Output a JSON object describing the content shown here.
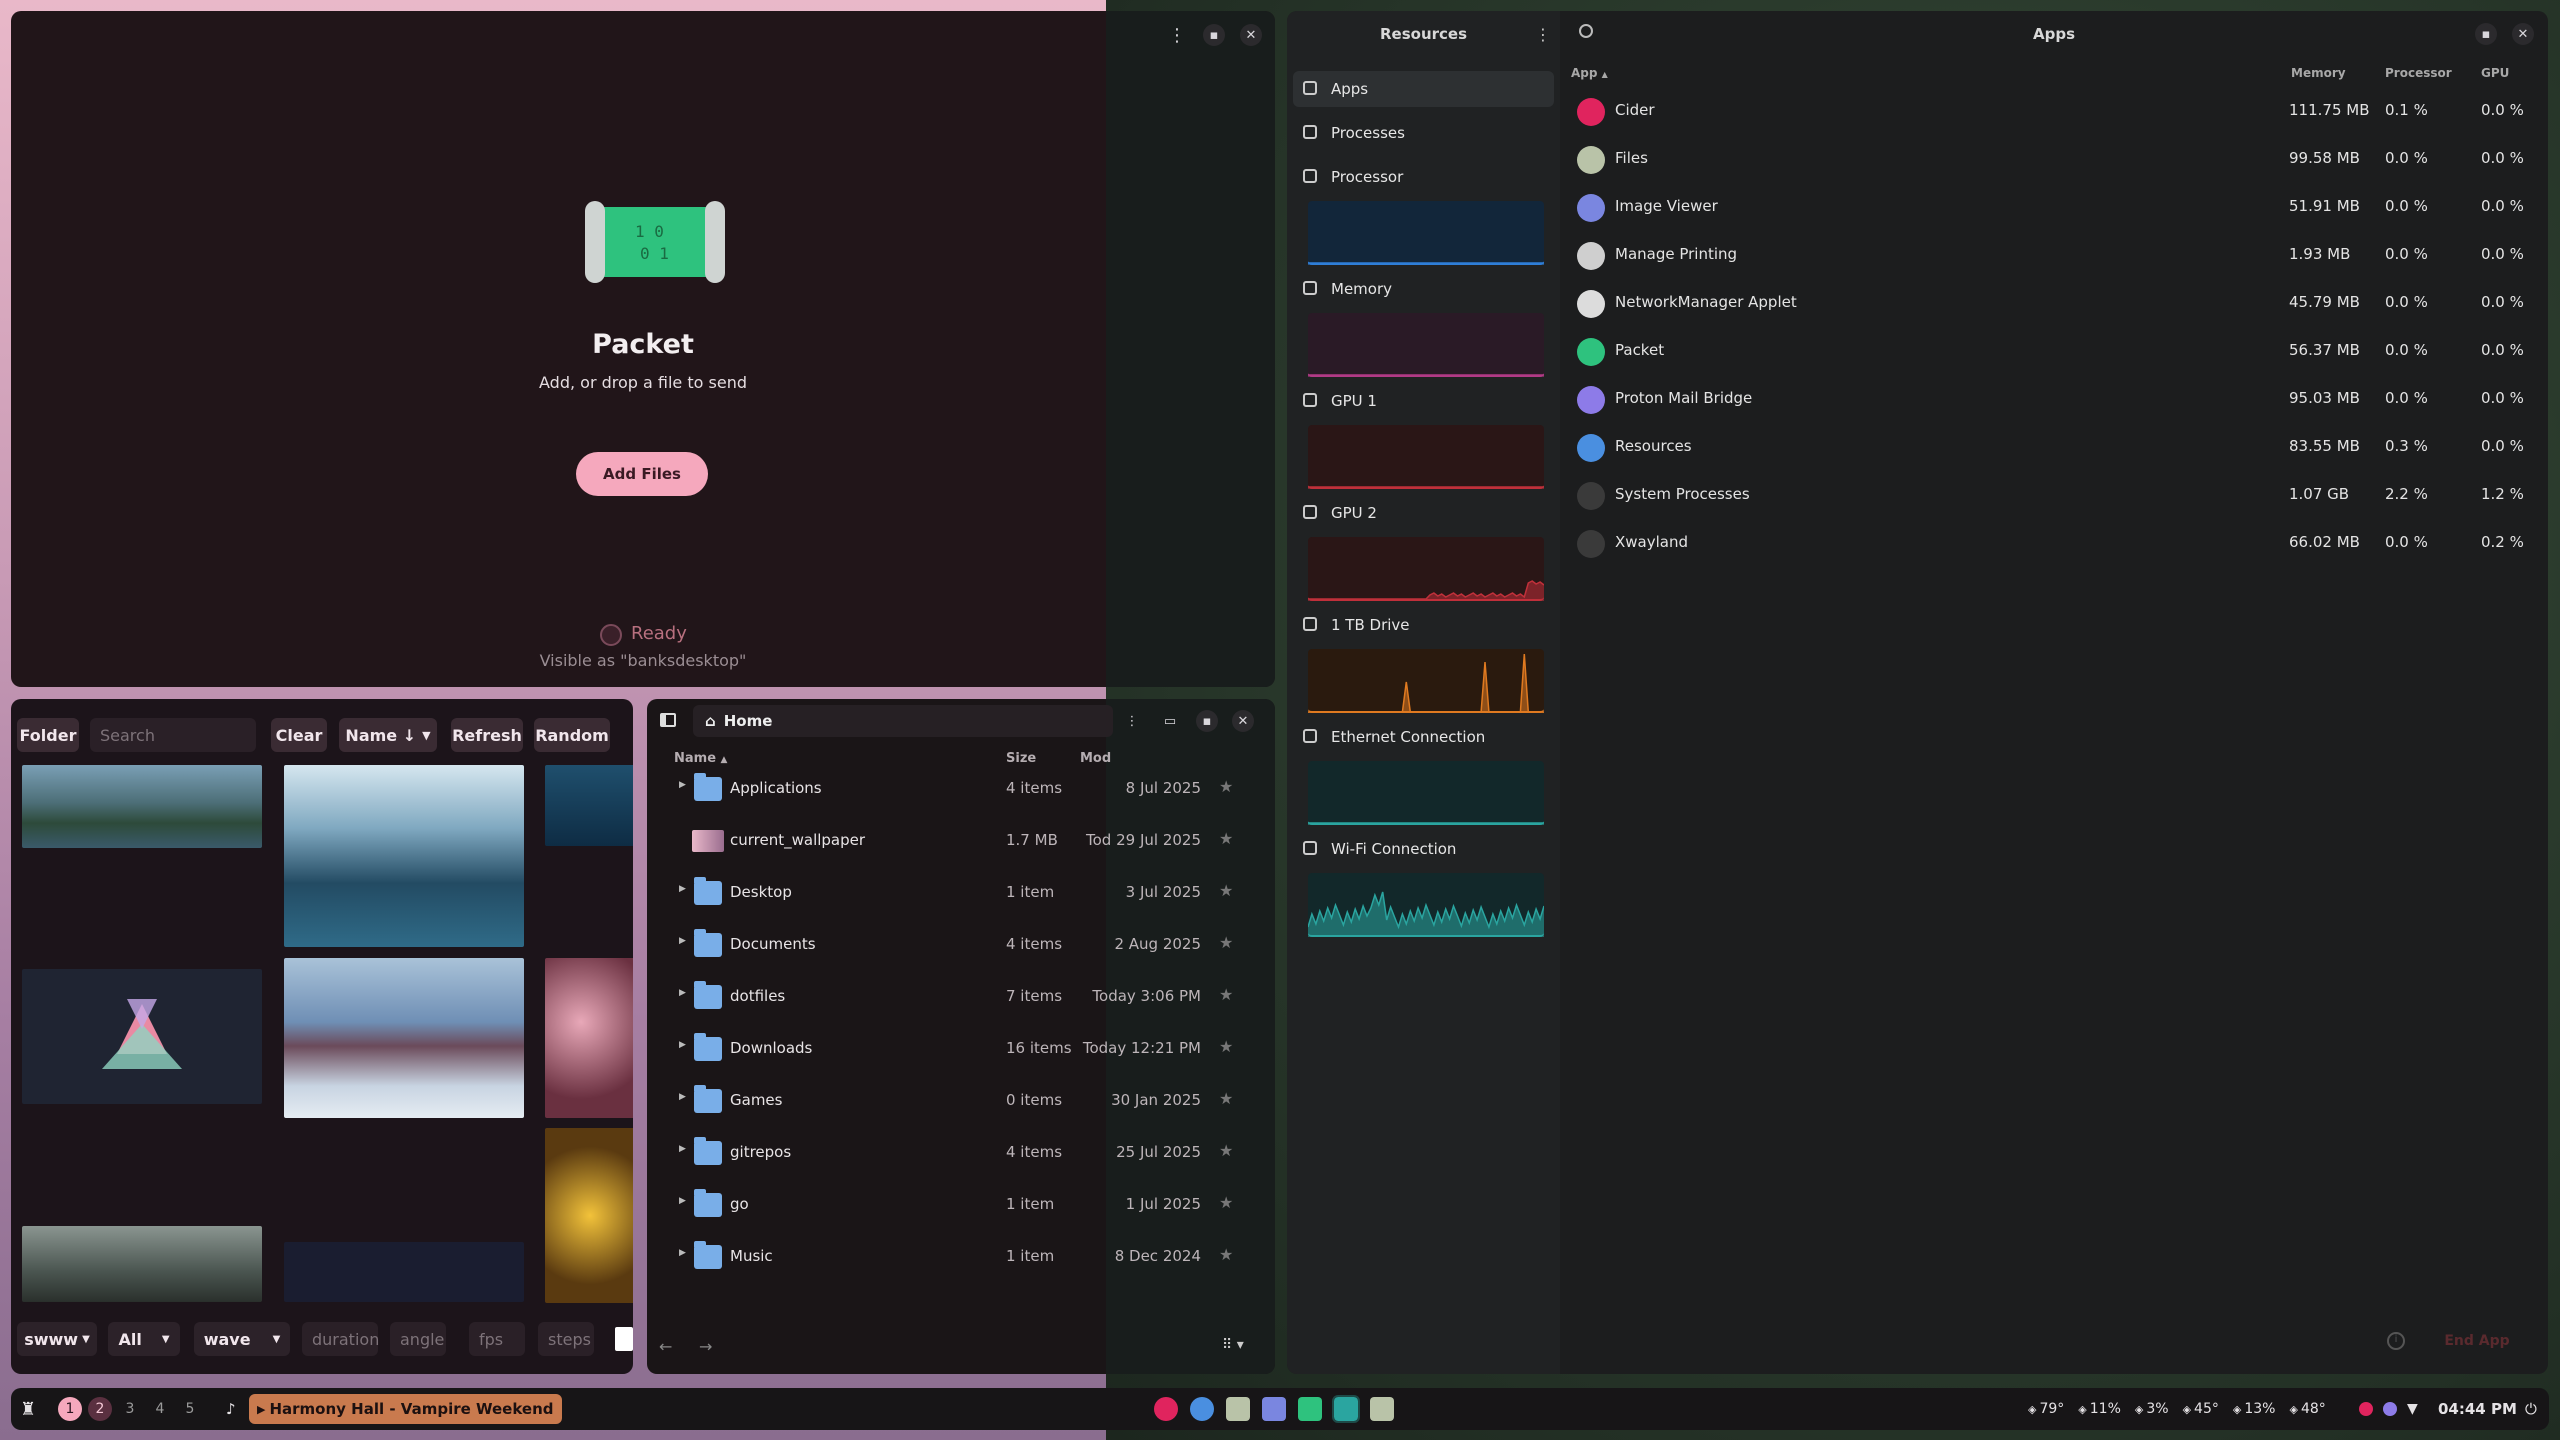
{
  "packet": {
    "title": "Packet",
    "subtitle": "Add, or drop a file to send",
    "add_button": "Add Files",
    "status": "Ready",
    "visible_as": "Visible as \"banksdesktop\""
  },
  "wallpaper_picker": {
    "folder_button": "Folder",
    "search_placeholder": "Search",
    "clear_button": "Clear",
    "sort_button": "Name ↓",
    "refresh_button": "Refresh",
    "random_button": "Random",
    "backend": "swww",
    "filter": "All",
    "transition": "wave",
    "duration_placeholder": "duration",
    "angle_placeholder": "angle",
    "fps_placeholder": "fps",
    "steps_placeholder": "steps"
  },
  "files": {
    "location": "Home",
    "col_name": "Name",
    "col_size": "Size",
    "col_modified": "Mod",
    "rows": [
      {
        "name": "Applications",
        "size": "4 items",
        "modified": "8 Jul 2025",
        "type": "folder"
      },
      {
        "name": "current_wallpaper",
        "size": "1.7 MB",
        "modified": "Tod 29 Jul 2025",
        "type": "image"
      },
      {
        "name": "Desktop",
        "size": "1 item",
        "modified": "3 Jul 2025",
        "type": "folder"
      },
      {
        "name": "Documents",
        "size": "4 items",
        "modified": "2 Aug 2025",
        "type": "folder"
      },
      {
        "name": "dotfiles",
        "size": "7 items",
        "modified": "Today 3:06 PM",
        "type": "folder"
      },
      {
        "name": "Downloads",
        "size": "16 items",
        "modified": "Today 12:21 PM",
        "type": "folder"
      },
      {
        "name": "Games",
        "size": "0 items",
        "modified": "30 Jan 2025",
        "type": "folder"
      },
      {
        "name": "gitrepos",
        "size": "4 items",
        "modified": "25 Jul 2025",
        "type": "folder"
      },
      {
        "name": "go",
        "size": "1 item",
        "modified": "1 Jul 2025",
        "type": "folder"
      },
      {
        "name": "Music",
        "size": "1 item",
        "modified": "8 Dec 2024",
        "type": "folder"
      }
    ]
  },
  "resources": {
    "sidebar_title": "Resources",
    "main_title": "Apps",
    "sidebar_items": [
      {
        "label": "Apps",
        "icon": "apps-icon"
      },
      {
        "label": "Processes",
        "icon": "processes-icon"
      },
      {
        "label": "Processor",
        "icon": "cpu-icon"
      },
      {
        "label": "Memory",
        "icon": "memory-icon"
      },
      {
        "label": "GPU 1",
        "icon": "gpu-icon"
      },
      {
        "label": "GPU 2",
        "icon": "gpu-icon"
      },
      {
        "label": "1 TB Drive",
        "icon": "drive-icon"
      },
      {
        "label": "Ethernet Connection",
        "icon": "ethernet-icon"
      },
      {
        "label": "Wi-Fi Connection",
        "icon": "wifi-icon"
      }
    ],
    "col_app": "App",
    "col_memory": "Memory",
    "col_processor": "Processor",
    "col_gpu": "GPU",
    "apps": [
      {
        "name": "Cider",
        "memory": "111.75 MB",
        "processor": "0.1 %",
        "gpu": "0.0 %",
        "color": "#e0245e"
      },
      {
        "name": "Files",
        "memory": "99.58 MB",
        "processor": "0.0 %",
        "gpu": "0.0 %",
        "color": "#b9c3a8"
      },
      {
        "name": "Image Viewer",
        "memory": "51.91 MB",
        "processor": "0.0 %",
        "gpu": "0.0 %",
        "color": "#7a86e0"
      },
      {
        "name": "Manage Printing",
        "memory": "1.93 MB",
        "processor": "0.0 %",
        "gpu": "0.0 %",
        "color": "#cfcfcf"
      },
      {
        "name": "NetworkManager Applet",
        "memory": "45.79 MB",
        "processor": "0.0 %",
        "gpu": "0.0 %",
        "color": "#dcdcdc"
      },
      {
        "name": "Packet",
        "memory": "56.37 MB",
        "processor": "0.0 %",
        "gpu": "0.0 %",
        "color": "#2ec27e"
      },
      {
        "name": "Proton Mail Bridge",
        "memory": "95.03 MB",
        "processor": "0.0 %",
        "gpu": "0.0 %",
        "color": "#8d7be8"
      },
      {
        "name": "Resources",
        "memory": "83.55 MB",
        "processor": "0.3 %",
        "gpu": "0.0 %",
        "color": "#4a8fe0"
      },
      {
        "name": "System Processes",
        "memory": "1.07 GB",
        "processor": "2.2 %",
        "gpu": "1.2 %",
        "color": "#3a3a3a"
      },
      {
        "name": "Xwayland",
        "memory": "66.02 MB",
        "processor": "0.0 %",
        "gpu": "0.2 %",
        "color": "#3a3a3a"
      }
    ],
    "end_app": "End App"
  },
  "taskbar": {
    "workspaces": [
      "1",
      "2",
      "3",
      "4",
      "5"
    ],
    "now_playing": "Harmony Hall - Vampire Weekend",
    "stats": [
      {
        "label": "79°",
        "icon": "temp-icon"
      },
      {
        "label": "11%",
        "icon": "memory-icon"
      },
      {
        "label": "3%",
        "icon": "cpu-icon"
      },
      {
        "label": "45°",
        "icon": "cpu-temp-icon"
      },
      {
        "label": "13%",
        "icon": "gpu-icon"
      },
      {
        "label": "48°",
        "icon": "gpu-temp-icon"
      }
    ],
    "clock": "04:44 PM"
  },
  "colors": {
    "accent_pink": "#f5a8bd",
    "graph_blue": "#2f7fd8",
    "graph_pink": "#b23b86",
    "graph_red": "#c0303a",
    "graph_orange": "#e07a20",
    "graph_teal": "#2aa5a0"
  }
}
